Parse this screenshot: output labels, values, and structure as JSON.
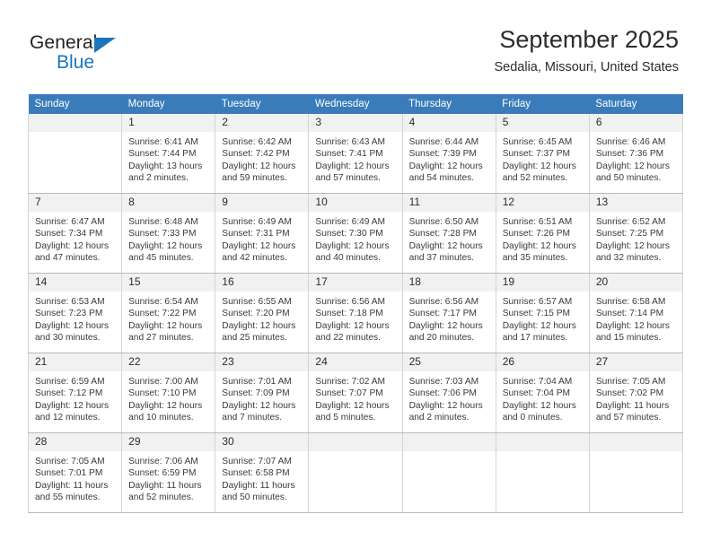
{
  "brand": {
    "name_dark": "General",
    "name_blue": "Blue",
    "accent_color": "#1b75bb"
  },
  "header": {
    "title": "September 2025",
    "location": "Sedalia, Missouri, United States",
    "header_bg": "#3a7cba",
    "daynum_bg": "#f1f1f1"
  },
  "weekdays": [
    "Sunday",
    "Monday",
    "Tuesday",
    "Wednesday",
    "Thursday",
    "Friday",
    "Saturday"
  ],
  "labels": {
    "sunrise_prefix": "Sunrise:",
    "sunset_prefix": "Sunset:",
    "daylight_prefix": "Daylight:"
  },
  "weeks": [
    [
      {
        "day": "",
        "blank": true
      },
      {
        "day": "1",
        "sunrise": "Sunrise: 6:41 AM",
        "sunset": "Sunset: 7:44 PM",
        "daylight_line1": "Daylight: 13 hours",
        "daylight_line2": "and 2 minutes."
      },
      {
        "day": "2",
        "sunrise": "Sunrise: 6:42 AM",
        "sunset": "Sunset: 7:42 PM",
        "daylight_line1": "Daylight: 12 hours",
        "daylight_line2": "and 59 minutes."
      },
      {
        "day": "3",
        "sunrise": "Sunrise: 6:43 AM",
        "sunset": "Sunset: 7:41 PM",
        "daylight_line1": "Daylight: 12 hours",
        "daylight_line2": "and 57 minutes."
      },
      {
        "day": "4",
        "sunrise": "Sunrise: 6:44 AM",
        "sunset": "Sunset: 7:39 PM",
        "daylight_line1": "Daylight: 12 hours",
        "daylight_line2": "and 54 minutes."
      },
      {
        "day": "5",
        "sunrise": "Sunrise: 6:45 AM",
        "sunset": "Sunset: 7:37 PM",
        "daylight_line1": "Daylight: 12 hours",
        "daylight_line2": "and 52 minutes."
      },
      {
        "day": "6",
        "sunrise": "Sunrise: 6:46 AM",
        "sunset": "Sunset: 7:36 PM",
        "daylight_line1": "Daylight: 12 hours",
        "daylight_line2": "and 50 minutes."
      }
    ],
    [
      {
        "day": "7",
        "sunrise": "Sunrise: 6:47 AM",
        "sunset": "Sunset: 7:34 PM",
        "daylight_line1": "Daylight: 12 hours",
        "daylight_line2": "and 47 minutes."
      },
      {
        "day": "8",
        "sunrise": "Sunrise: 6:48 AM",
        "sunset": "Sunset: 7:33 PM",
        "daylight_line1": "Daylight: 12 hours",
        "daylight_line2": "and 45 minutes."
      },
      {
        "day": "9",
        "sunrise": "Sunrise: 6:49 AM",
        "sunset": "Sunset: 7:31 PM",
        "daylight_line1": "Daylight: 12 hours",
        "daylight_line2": "and 42 minutes."
      },
      {
        "day": "10",
        "sunrise": "Sunrise: 6:49 AM",
        "sunset": "Sunset: 7:30 PM",
        "daylight_line1": "Daylight: 12 hours",
        "daylight_line2": "and 40 minutes."
      },
      {
        "day": "11",
        "sunrise": "Sunrise: 6:50 AM",
        "sunset": "Sunset: 7:28 PM",
        "daylight_line1": "Daylight: 12 hours",
        "daylight_line2": "and 37 minutes."
      },
      {
        "day": "12",
        "sunrise": "Sunrise: 6:51 AM",
        "sunset": "Sunset: 7:26 PM",
        "daylight_line1": "Daylight: 12 hours",
        "daylight_line2": "and 35 minutes."
      },
      {
        "day": "13",
        "sunrise": "Sunrise: 6:52 AM",
        "sunset": "Sunset: 7:25 PM",
        "daylight_line1": "Daylight: 12 hours",
        "daylight_line2": "and 32 minutes."
      }
    ],
    [
      {
        "day": "14",
        "sunrise": "Sunrise: 6:53 AM",
        "sunset": "Sunset: 7:23 PM",
        "daylight_line1": "Daylight: 12 hours",
        "daylight_line2": "and 30 minutes."
      },
      {
        "day": "15",
        "sunrise": "Sunrise: 6:54 AM",
        "sunset": "Sunset: 7:22 PM",
        "daylight_line1": "Daylight: 12 hours",
        "daylight_line2": "and 27 minutes."
      },
      {
        "day": "16",
        "sunrise": "Sunrise: 6:55 AM",
        "sunset": "Sunset: 7:20 PM",
        "daylight_line1": "Daylight: 12 hours",
        "daylight_line2": "and 25 minutes."
      },
      {
        "day": "17",
        "sunrise": "Sunrise: 6:56 AM",
        "sunset": "Sunset: 7:18 PM",
        "daylight_line1": "Daylight: 12 hours",
        "daylight_line2": "and 22 minutes."
      },
      {
        "day": "18",
        "sunrise": "Sunrise: 6:56 AM",
        "sunset": "Sunset: 7:17 PM",
        "daylight_line1": "Daylight: 12 hours",
        "daylight_line2": "and 20 minutes."
      },
      {
        "day": "19",
        "sunrise": "Sunrise: 6:57 AM",
        "sunset": "Sunset: 7:15 PM",
        "daylight_line1": "Daylight: 12 hours",
        "daylight_line2": "and 17 minutes."
      },
      {
        "day": "20",
        "sunrise": "Sunrise: 6:58 AM",
        "sunset": "Sunset: 7:14 PM",
        "daylight_line1": "Daylight: 12 hours",
        "daylight_line2": "and 15 minutes."
      }
    ],
    [
      {
        "day": "21",
        "sunrise": "Sunrise: 6:59 AM",
        "sunset": "Sunset: 7:12 PM",
        "daylight_line1": "Daylight: 12 hours",
        "daylight_line2": "and 12 minutes."
      },
      {
        "day": "22",
        "sunrise": "Sunrise: 7:00 AM",
        "sunset": "Sunset: 7:10 PM",
        "daylight_line1": "Daylight: 12 hours",
        "daylight_line2": "and 10 minutes."
      },
      {
        "day": "23",
        "sunrise": "Sunrise: 7:01 AM",
        "sunset": "Sunset: 7:09 PM",
        "daylight_line1": "Daylight: 12 hours",
        "daylight_line2": "and 7 minutes."
      },
      {
        "day": "24",
        "sunrise": "Sunrise: 7:02 AM",
        "sunset": "Sunset: 7:07 PM",
        "daylight_line1": "Daylight: 12 hours",
        "daylight_line2": "and 5 minutes."
      },
      {
        "day": "25",
        "sunrise": "Sunrise: 7:03 AM",
        "sunset": "Sunset: 7:06 PM",
        "daylight_line1": "Daylight: 12 hours",
        "daylight_line2": "and 2 minutes."
      },
      {
        "day": "26",
        "sunrise": "Sunrise: 7:04 AM",
        "sunset": "Sunset: 7:04 PM",
        "daylight_line1": "Daylight: 12 hours",
        "daylight_line2": "and 0 minutes."
      },
      {
        "day": "27",
        "sunrise": "Sunrise: 7:05 AM",
        "sunset": "Sunset: 7:02 PM",
        "daylight_line1": "Daylight: 11 hours",
        "daylight_line2": "and 57 minutes."
      }
    ],
    [
      {
        "day": "28",
        "sunrise": "Sunrise: 7:05 AM",
        "sunset": "Sunset: 7:01 PM",
        "daylight_line1": "Daylight: 11 hours",
        "daylight_line2": "and 55 minutes."
      },
      {
        "day": "29",
        "sunrise": "Sunrise: 7:06 AM",
        "sunset": "Sunset: 6:59 PM",
        "daylight_line1": "Daylight: 11 hours",
        "daylight_line2": "and 52 minutes."
      },
      {
        "day": "30",
        "sunrise": "Sunrise: 7:07 AM",
        "sunset": "Sunset: 6:58 PM",
        "daylight_line1": "Daylight: 11 hours",
        "daylight_line2": "and 50 minutes."
      },
      {
        "day": "",
        "blank": true
      },
      {
        "day": "",
        "blank": true
      },
      {
        "day": "",
        "blank": true
      },
      {
        "day": "",
        "blank": true
      }
    ]
  ]
}
